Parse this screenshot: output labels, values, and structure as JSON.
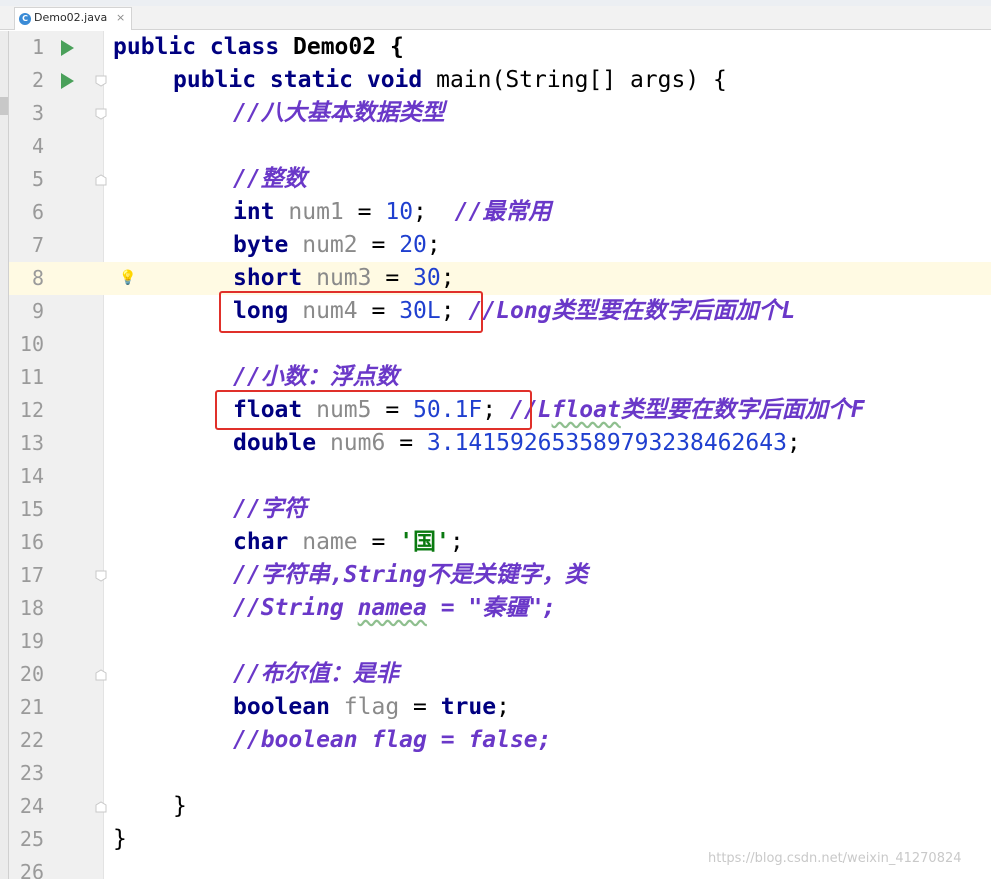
{
  "tab": {
    "filename": "Demo02.java",
    "icon": "java-class-icon",
    "close": "×"
  },
  "watermark": "https://blog.csdn.net/weixin_41270824",
  "colors": {
    "keyword": "#000080",
    "comment": "#6a38c8",
    "number": "#1f3fcf",
    "highlight": "#e0302a"
  },
  "code": {
    "l1": {
      "n": "1",
      "kw": "public class",
      "rest": " Demo02 {"
    },
    "l2": {
      "n": "2",
      "kw": "public static void",
      "rest": " main(String[] args) {"
    },
    "l3": {
      "n": "3",
      "c": "//八大基本数据类型"
    },
    "l4": {
      "n": "4"
    },
    "l5": {
      "n": "5",
      "c": "//整数"
    },
    "l6": {
      "n": "6",
      "kw": "int",
      "v": " num1",
      "eq": " = ",
      "num": "10",
      "semi": ";  ",
      "c": "//最常用"
    },
    "l7": {
      "n": "7",
      "kw": "byte",
      "v": " num2",
      "eq": " = ",
      "num": "20",
      "semi": ";"
    },
    "l8": {
      "n": "8",
      "kw": "short",
      "v": " num3",
      "eq": " = ",
      "num": "30",
      "semi": ";"
    },
    "l9": {
      "n": "9",
      "kw": "long",
      "v": " num4",
      "eq": " = ",
      "num": "30L",
      "semi": "; ",
      "c": "//Long类型要在数字后面加个L"
    },
    "l10": {
      "n": "10"
    },
    "l11": {
      "n": "11",
      "c": "//小数：浮点数"
    },
    "l12": {
      "n": "12",
      "kw": "float",
      "v": " num5",
      "eq": " = ",
      "num": "50.1F",
      "semi": "; ",
      "c1": "//L",
      "cw": "float",
      "c2": "类型要在数字后面加个F"
    },
    "l13": {
      "n": "13",
      "kw": "double",
      "v": " num6",
      "eq": " = ",
      "num": "3.141592653589793238462643",
      "semi": ";"
    },
    "l14": {
      "n": "14"
    },
    "l15": {
      "n": "15",
      "c": "//字符"
    },
    "l16": {
      "n": "16",
      "kw": "char",
      "v": " name",
      "eq": " = ",
      "s": "'国'",
      "semi": ";"
    },
    "l17": {
      "n": "17",
      "c": "//字符串,String不是关键字，类"
    },
    "l18": {
      "n": "18",
      "c1": "//String ",
      "cw": "namea",
      "c2": " = \"秦疆\";"
    },
    "l19": {
      "n": "19"
    },
    "l20": {
      "n": "20",
      "c": "//布尔值：是非"
    },
    "l21": {
      "n": "21",
      "kw": "boolean",
      "v": " flag",
      "eq": " = ",
      "kw2": "true",
      "semi": ";"
    },
    "l22": {
      "n": "22",
      "c": "//boolean flag = false;"
    },
    "l23": {
      "n": "23"
    },
    "l24": {
      "n": "24",
      "rest": "}"
    },
    "l25": {
      "n": "25",
      "rest": "}"
    },
    "l26": {
      "n": "26"
    }
  }
}
